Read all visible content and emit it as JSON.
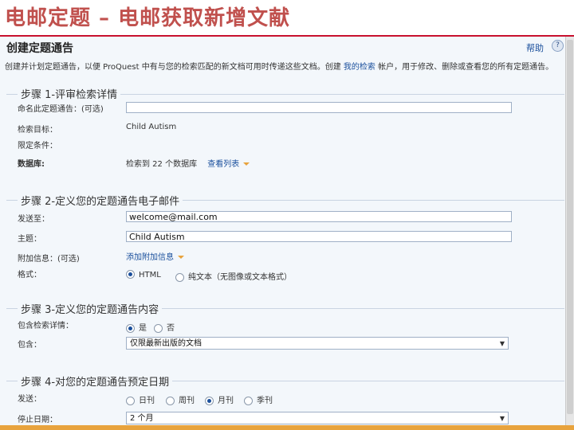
{
  "slide_title": "电邮定题 – 电邮获取新增文献",
  "header": {
    "title": "创建定题通告",
    "help": "帮助"
  },
  "intro": {
    "part1": "创建并计划定题通告，以便 ProQuest 中有与您的检索匹配的新文档可用时传递这些文档。创建",
    "link": "我的检索",
    "part2": "帐户，用于修改、删除或查看您的所有定题通告。"
  },
  "step1": {
    "legend": "步骤 1-评审检索详情",
    "name_label": "命名此定题通告：(可选)",
    "name_value": "",
    "target_label": "检索目标：",
    "target_value": "Child Autism",
    "limits_label": "限定条件：",
    "db_label": "数据库:",
    "db_value": "检索到 22 个数据库",
    "db_link": "查看列表"
  },
  "step2": {
    "legend": "步骤 2-定义您的定题通告电子邮件",
    "to_label": "发送至：",
    "to_value": "welcome@mail.com",
    "subject_label": "主题：",
    "subject_value": "Child Autism",
    "extra_label": "附加信息：(可选)",
    "extra_link": "添加附加信息",
    "format_label": "格式：",
    "format_options": [
      "HTML",
      "纯文本（无图像或文本格式）"
    ]
  },
  "step3": {
    "legend": "步骤 3-定义您的定题通告内容",
    "include_details_label": "包含检索详情：",
    "include_details_options": [
      "是",
      "否"
    ],
    "include_label": "包含：",
    "include_value": "仅限最新出版的文档"
  },
  "step4": {
    "legend": "步骤 4-对您的定题通告预定日期",
    "send_label": "发送：",
    "send_options": [
      "日刊",
      "周刊",
      "月刊",
      "季刊"
    ],
    "stop_label": "停止日期：",
    "stop_value": "2 个月"
  }
}
